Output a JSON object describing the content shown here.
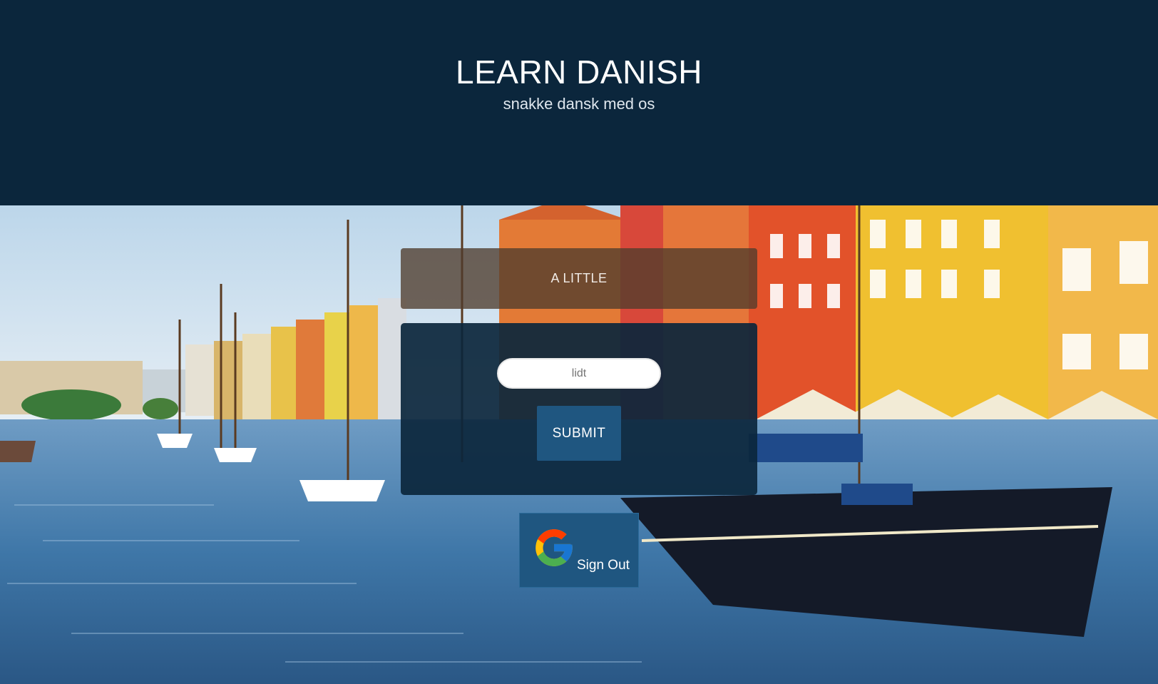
{
  "header": {
    "title": "LEARN DANISH",
    "subtitle": "snakke dansk med os"
  },
  "quiz": {
    "prompt": "A LITTLE",
    "answer_value": "",
    "answer_placeholder": "lidt",
    "submit_label": "SUBMIT"
  },
  "auth": {
    "signout_label": "Sign Out",
    "provider_icon": "google-g-icon"
  },
  "colors": {
    "header_bg": "#0b263c",
    "button_bg": "#1f5680"
  }
}
